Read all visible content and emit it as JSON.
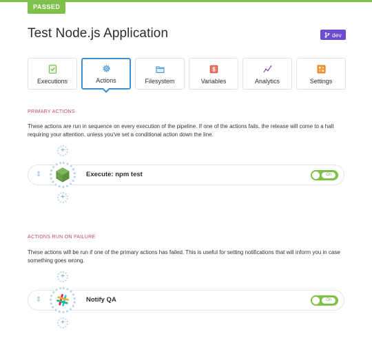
{
  "status": {
    "label": "PASSED",
    "color": "#7fc04a"
  },
  "header": {
    "title": "Test Node.js Application",
    "env_badge": {
      "label": "dev",
      "icon": "branch-icon",
      "color": "#6c4cd0"
    }
  },
  "tabs": [
    {
      "label": "Executions",
      "icon": "checklist-icon",
      "active": false
    },
    {
      "label": "Actions",
      "icon": "gear-icon",
      "active": true
    },
    {
      "label": "Filesystem",
      "icon": "folder-icon",
      "active": false
    },
    {
      "label": "Variables",
      "icon": "dollar-icon",
      "active": false
    },
    {
      "label": "Analytics",
      "icon": "line-chart-icon",
      "active": false
    },
    {
      "label": "Settings",
      "icon": "settings-icon",
      "active": false
    }
  ],
  "primary": {
    "title": "PRIMARY ACTIONS",
    "description": "These actions are run in sequence on every execution of the pipeline. If one of the actions fails, the release will come to a halt requiring your attention, unless you've set a conditional action down the line.",
    "actions": [
      {
        "name": "Execute: npm test",
        "icon": "nodejs-icon",
        "toggle": "On"
      }
    ]
  },
  "failure": {
    "title": "ACTIONS RUN ON FAILURE",
    "description": "These actions will be run if one of the primary actions has failed. This is useful for setting notifications that will inform you in case something goes wrong.",
    "actions": [
      {
        "name": "Notify QA",
        "icon": "slack-icon",
        "toggle": "On"
      }
    ]
  }
}
